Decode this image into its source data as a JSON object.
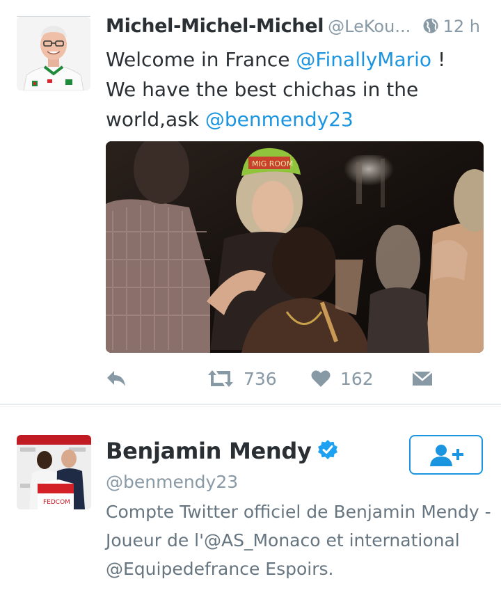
{
  "tweet": {
    "author_name": "Michel-Michel-Michel",
    "author_handle": "@LeKou...",
    "time": "12 h",
    "text_parts": {
      "line1_a": "Welcome in France ",
      "mention1": "@FinallyMario",
      "line1_b": " !",
      "line2": "We have the best chichas in the",
      "line3_a": "world,ask ",
      "mention2": "@benmendy23"
    },
    "media_caption_cap": "MIG ROOM",
    "actions": {
      "reply_icon": "reply-icon",
      "retweet_icon": "retweet-icon",
      "retweet_count": "736",
      "like_icon": "heart-icon",
      "like_count": "162",
      "dm_icon": "envelope-icon"
    }
  },
  "user_card": {
    "name": "Benjamin Mendy",
    "verified_icon": "verified-badge-icon",
    "handle": "@benmendy23",
    "bio_parts": {
      "line1": "Compte Twitter officiel de Benjamin Mendy -",
      "line2_a": "Joueur de l'",
      "mention1": "@AS_Monaco",
      "line2_b": " et international",
      "mention2": "@Equipedefrance",
      "line3_b": " Espoirs."
    },
    "avatar_banner_text": "FEDCOM",
    "follow_icon": "follow-user-icon"
  },
  "colors": {
    "link": "#1b95e0",
    "muted": "#8899a6",
    "text": "#292f33",
    "bio": "#66757f",
    "verified": "#1da1f2"
  }
}
